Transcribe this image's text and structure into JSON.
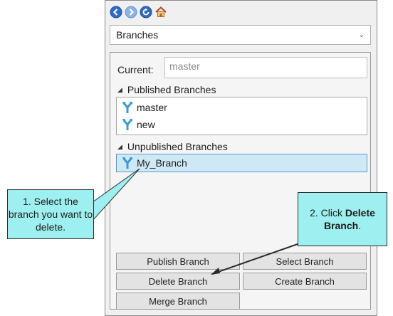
{
  "toolbar": {
    "icons": [
      "back-icon",
      "forward-icon",
      "refresh-icon",
      "home-icon"
    ]
  },
  "view_select": {
    "value": "Branches"
  },
  "current": {
    "label": "Current:",
    "placeholder": "master"
  },
  "published": {
    "heading": "Published Branches",
    "items": [
      {
        "label": "master"
      },
      {
        "label": "new"
      }
    ]
  },
  "unpublished": {
    "heading": "Unpublished Branches",
    "items": [
      {
        "label": "My_Branch",
        "selected": true
      }
    ]
  },
  "buttons": {
    "publish": "Publish Branch",
    "select": "Select Branch",
    "delete": "Delete Branch",
    "create": "Create Branch",
    "merge": "Merge Branch"
  },
  "callouts": {
    "step1": "1. Select the branch you want to delete.",
    "step2_prefix": "2. Click ",
    "step2_bold": "Delete Branch",
    "step2_suffix": "."
  },
  "colors": {
    "callout_fill": "#9df0ef",
    "selection": "#cfe8f6",
    "selection_border": "#4f9fd5",
    "nav_blue": "#2e6cc9"
  }
}
